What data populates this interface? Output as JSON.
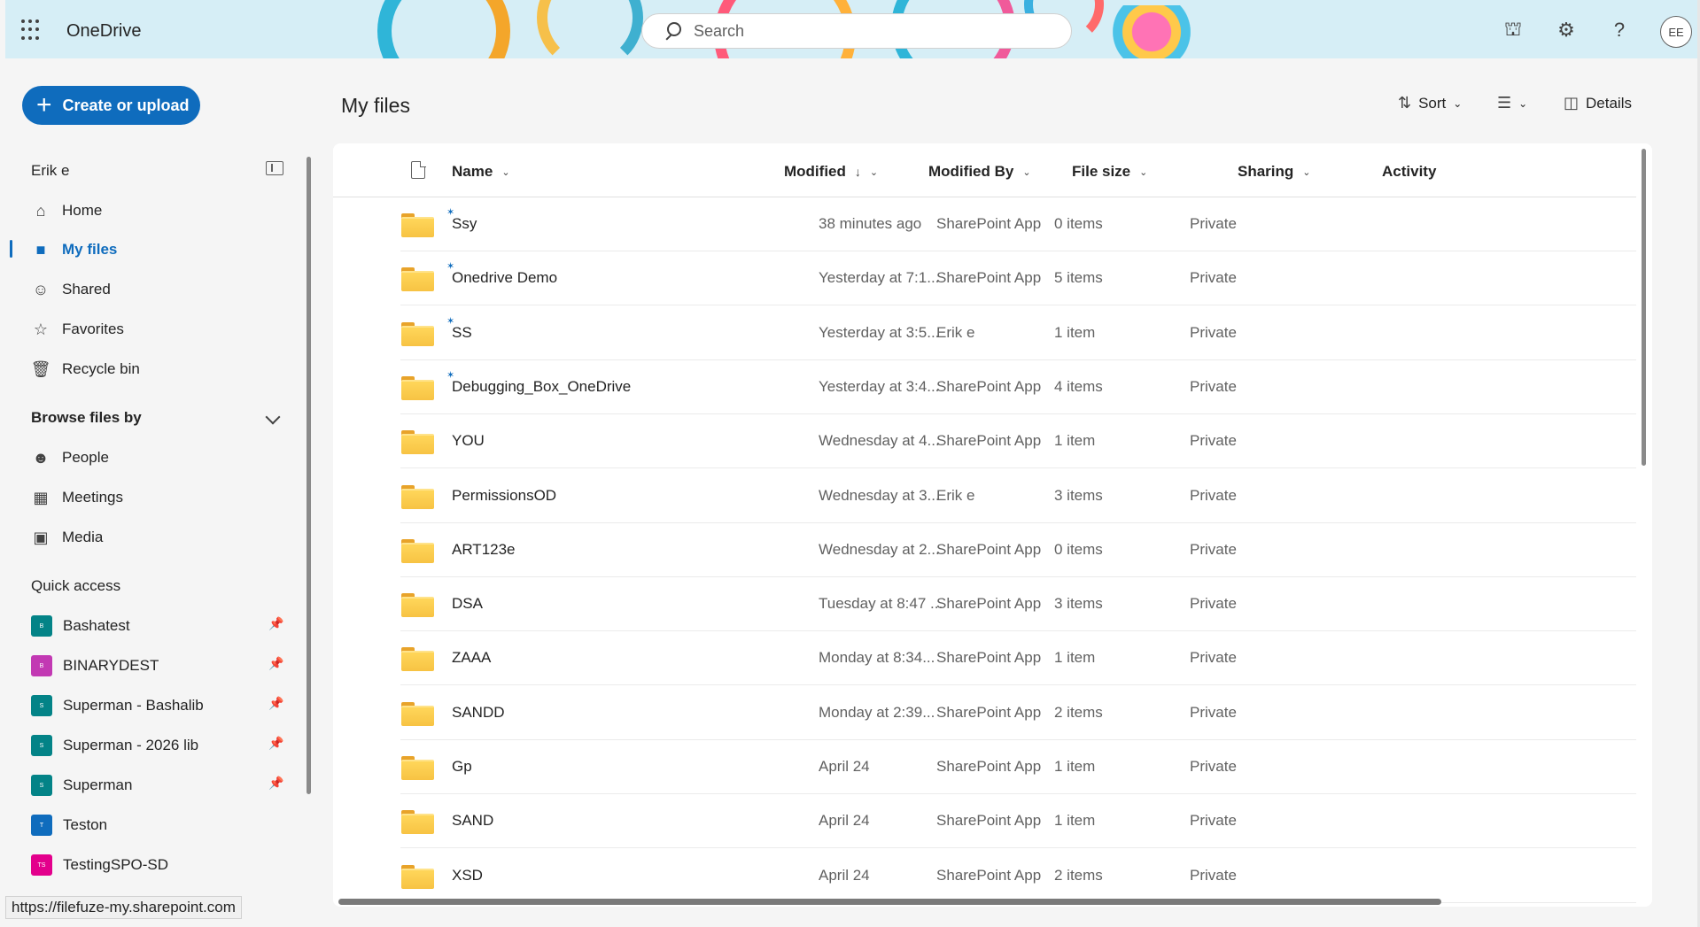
{
  "header": {
    "app_title": "OneDrive",
    "search_placeholder": "Search",
    "avatar_initials": "EE",
    "icons": [
      "app-launcher-icon",
      "feedback-icon",
      "settings-icon",
      "help-icon"
    ]
  },
  "nav": {
    "create_label": "Create or upload",
    "user_name": "Erik e",
    "items": [
      {
        "label": "Home",
        "icon": "home-icon"
      },
      {
        "label": "My files",
        "icon": "folder-icon",
        "active": true
      },
      {
        "label": "Shared",
        "icon": "people-icon"
      },
      {
        "label": "Favorites",
        "icon": "star-icon"
      },
      {
        "label": "Recycle bin",
        "icon": "trash-icon"
      }
    ],
    "browse_heading": "Browse files by",
    "browse_items": [
      {
        "label": "People",
        "icon": "person-icon"
      },
      {
        "label": "Meetings",
        "icon": "calendar-icon"
      },
      {
        "label": "Media",
        "icon": "image-icon"
      }
    ],
    "quick_access_heading": "Quick access",
    "quick_access": [
      {
        "label": "Bashatest",
        "initial": "B",
        "color": "#038387",
        "pinned": true
      },
      {
        "label": "BINARYDEST",
        "initial": "B",
        "color": "#c239b3",
        "pinned": true
      },
      {
        "label": "Superman - Bashalib",
        "initial": "S",
        "color": "#038387",
        "pinned": true
      },
      {
        "label": "Superman - 2026 lib",
        "initial": "S",
        "color": "#038387",
        "pinned": true
      },
      {
        "label": "Superman",
        "initial": "S",
        "color": "#038387",
        "pinned": true
      },
      {
        "label": "Teston",
        "initial": "T",
        "color": "#0f6cbd",
        "pinned": false
      },
      {
        "label": "TestingSPO-SD",
        "initial": "TS",
        "color": "#e3008c",
        "pinned": false
      }
    ]
  },
  "status_url": "https://filefuze-my.sharepoint.com",
  "main": {
    "title": "My files",
    "toolbar": {
      "sort_label": "Sort",
      "details_label": "Details"
    },
    "columns": {
      "name": "Name",
      "modified": "Modified",
      "modified_by": "Modified By",
      "file_size": "File size",
      "sharing": "Sharing",
      "activity": "Activity"
    },
    "rows": [
      {
        "name": "Ssy",
        "new": true,
        "modified": "38 minutes ago",
        "modified_by": "SharePoint App",
        "size": "0 items",
        "sharing": "Private"
      },
      {
        "name": "Onedrive Demo",
        "new": true,
        "modified": "Yesterday at 7:1...",
        "modified_by": "SharePoint App",
        "size": "5 items",
        "sharing": "Private"
      },
      {
        "name": "SS",
        "new": true,
        "modified": "Yesterday at 3:5...",
        "modified_by": "Erik e",
        "size": "1 item",
        "sharing": "Private"
      },
      {
        "name": "Debugging_Box_OneDrive",
        "new": true,
        "modified": "Yesterday at 3:4...",
        "modified_by": "SharePoint App",
        "size": "4 items",
        "sharing": "Private"
      },
      {
        "name": "YOU",
        "new": false,
        "modified": "Wednesday at 4...",
        "modified_by": "SharePoint App",
        "size": "1 item",
        "sharing": "Private"
      },
      {
        "name": "PermissionsOD",
        "new": false,
        "modified": "Wednesday at 3...",
        "modified_by": "Erik e",
        "size": "3 items",
        "sharing": "Private"
      },
      {
        "name": "ART123e",
        "new": false,
        "modified": "Wednesday at 2...",
        "modified_by": "SharePoint App",
        "size": "0 items",
        "sharing": "Private"
      },
      {
        "name": "DSA",
        "new": false,
        "modified": "Tuesday at 8:47 ...",
        "modified_by": "SharePoint App",
        "size": "3 items",
        "sharing": "Private"
      },
      {
        "name": "ZAAA",
        "new": false,
        "modified": "Monday at 8:34...",
        "modified_by": "SharePoint App",
        "size": "1 item",
        "sharing": "Private"
      },
      {
        "name": "SANDD",
        "new": false,
        "modified": "Monday at 2:39...",
        "modified_by": "SharePoint App",
        "size": "2 items",
        "sharing": "Private"
      },
      {
        "name": "Gp",
        "new": false,
        "modified": "April 24",
        "modified_by": "SharePoint App",
        "size": "1 item",
        "sharing": "Private"
      },
      {
        "name": "SAND",
        "new": false,
        "modified": "April 24",
        "modified_by": "SharePoint App",
        "size": "1 item",
        "sharing": "Private"
      },
      {
        "name": "XSD",
        "new": false,
        "modified": "April 24",
        "modified_by": "SharePoint App",
        "size": "2 items",
        "sharing": "Private"
      }
    ]
  }
}
